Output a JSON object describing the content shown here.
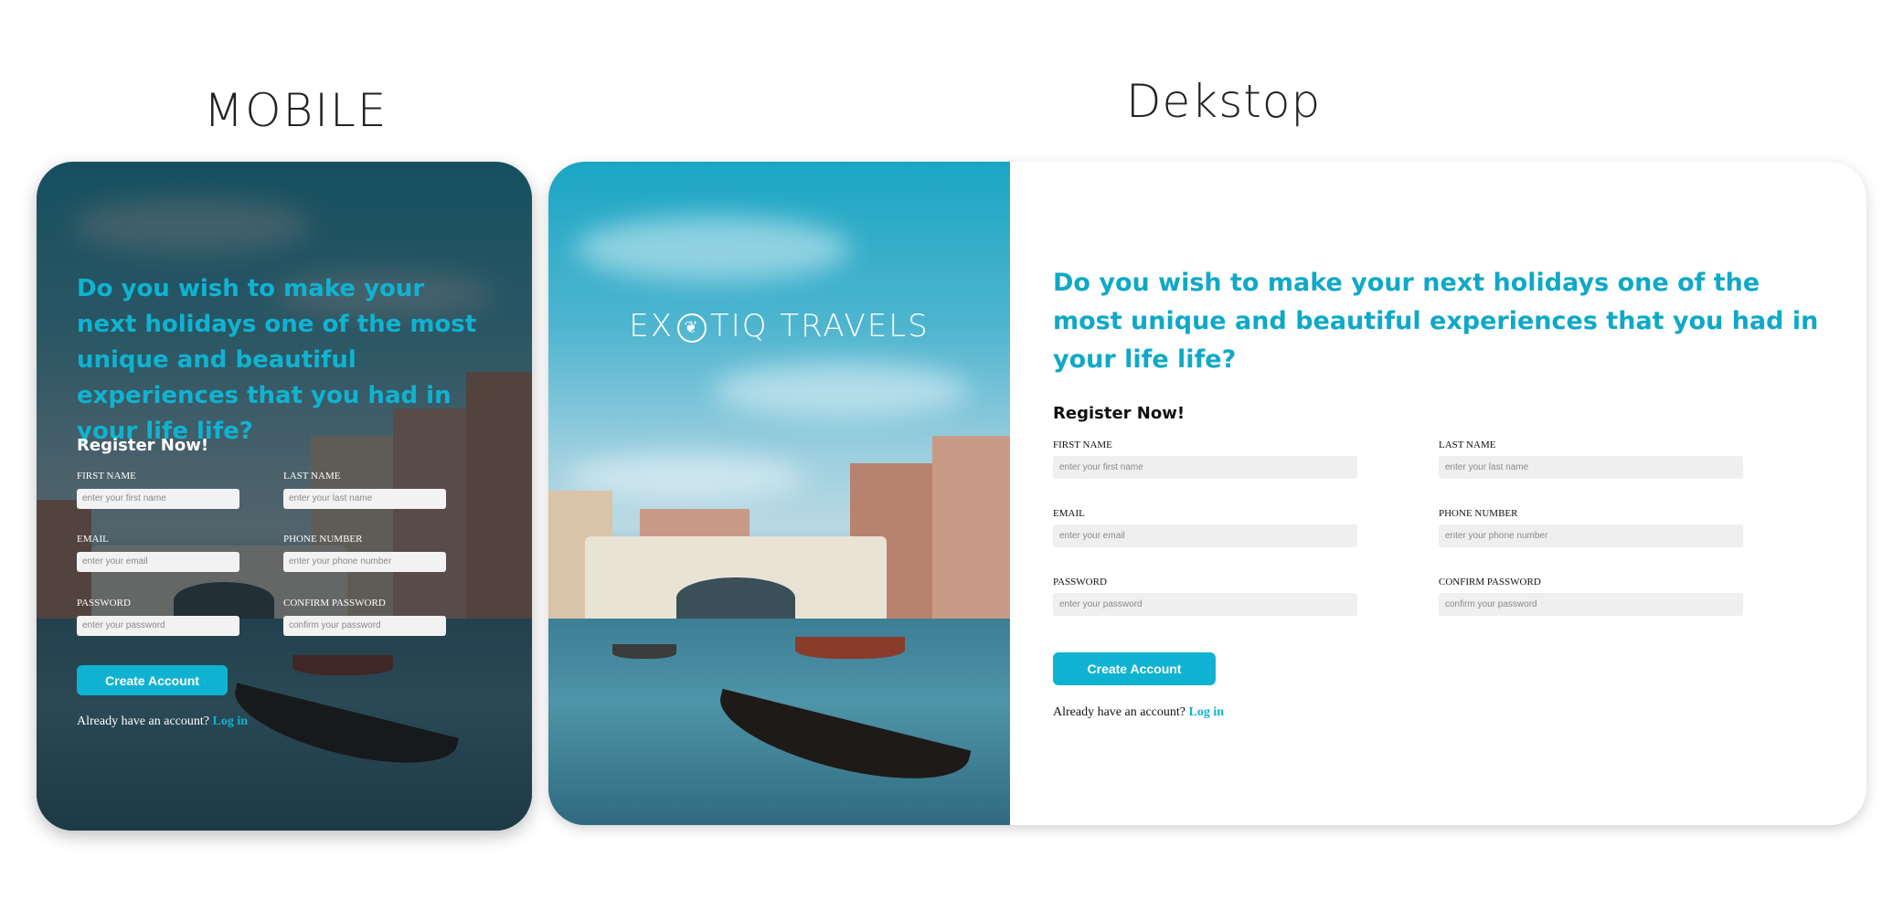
{
  "labels": {
    "mobile": "MOBILE",
    "desktop": "Dekstop"
  },
  "brand": {
    "name_left": "EX",
    "symbol": "❦",
    "name_right": "TIQ TRAVELS"
  },
  "form": {
    "heading_mobile": "Do you wish to make your next holidays one of the most unique and beautiful experiences that you had in your life life?",
    "heading_desktop": "Do you wish to make your next holidays one of the most unique and beautiful experiences that you had in your life life?",
    "register_title": "Register Now!",
    "fields": {
      "first_name": {
        "label": "FIRST NAME",
        "placeholder": "enter your first name"
      },
      "last_name": {
        "label": "LAST NAME",
        "placeholder": "enter your last name"
      },
      "email": {
        "label": "EMAIL",
        "placeholder": "enter your email"
      },
      "phone": {
        "label": "PHONE NUMBER",
        "placeholder": "enter your phone number"
      },
      "password": {
        "label": "PASSWORD",
        "placeholder": "enter your password"
      },
      "confirm_password": {
        "label": "CONFIRM PASSWORD",
        "placeholder": "confirm your password"
      }
    },
    "submit_label": "Create Account",
    "login_prompt": "Already have an account?",
    "login_link": "Log in"
  },
  "colors": {
    "accent": "#0fb3d1",
    "overlay": "#141c22",
    "input_bg": "#f2f2f2"
  }
}
